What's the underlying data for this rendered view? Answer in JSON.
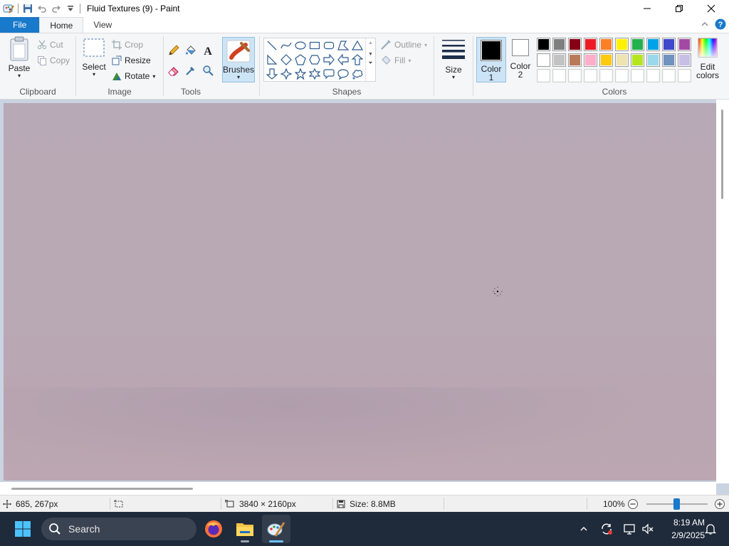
{
  "window": {
    "title": "Fluid Textures (9) - Paint"
  },
  "tabs": [
    {
      "label": "File"
    },
    {
      "label": "Home"
    },
    {
      "label": "View"
    }
  ],
  "clipboard": {
    "paste_label": "Paste",
    "cut_label": "Cut",
    "copy_label": "Copy",
    "group_label": "Clipboard"
  },
  "image": {
    "select_label": "Select",
    "crop_label": "Crop",
    "resize_label": "Resize",
    "rotate_label": "Rotate",
    "group_label": "Image"
  },
  "tools": {
    "group_label": "Tools",
    "icons": [
      "pencil-icon",
      "fill-bucket-icon",
      "text-icon",
      "eraser-icon",
      "color-picker-icon",
      "magnifier-icon"
    ]
  },
  "brushes": {
    "label": "Brushes"
  },
  "shapes": {
    "group_label": "Shapes",
    "outline_label": "Outline",
    "fill_label": "Fill",
    "items": [
      "line",
      "curve",
      "oval",
      "rectangle",
      "rounded-rectangle",
      "polygon",
      "triangle",
      "right-triangle",
      "diamond",
      "pentagon",
      "hexagon",
      "right-arrow",
      "left-arrow",
      "up-arrow",
      "down-arrow",
      "four-point-star",
      "five-point-star",
      "six-point-star",
      "rounded-callout",
      "oval-callout",
      "cloud-callout"
    ]
  },
  "size": {
    "label": "Size"
  },
  "color1": {
    "label_line1": "Color",
    "label_line2": "1",
    "value": "#000000"
  },
  "color2": {
    "label_line1": "Color",
    "label_line2": "2",
    "value": "#ffffff"
  },
  "colors": {
    "group_label": "Colors",
    "edit_label_line1": "Edit",
    "edit_label_line2": "colors",
    "palette_row1": [
      "#000000",
      "#7f7f7f",
      "#880015",
      "#ed1c24",
      "#ff7f27",
      "#fff200",
      "#22b14c",
      "#00a2e8",
      "#3f48cc",
      "#a349a4"
    ],
    "palette_row2": [
      "#ffffff",
      "#c3c3c3",
      "#b97a57",
      "#ffaec9",
      "#ffc90e",
      "#efe4b0",
      "#b5e61d",
      "#99d9ea",
      "#7092be",
      "#c8bfe7"
    ],
    "palette_row3": [
      "#ffffff",
      "#ffffff",
      "#ffffff",
      "#ffffff",
      "#ffffff",
      "#ffffff",
      "#ffffff",
      "#ffffff",
      "#ffffff",
      "#ffffff"
    ]
  },
  "status": {
    "cursor_pos": "685, 267px",
    "image_size": "3840 × 2160px",
    "file_size": "Size: 8.8MB",
    "zoom": "100%"
  },
  "taskbar": {
    "search_label": "Search",
    "time": "8:19 AM",
    "date": "2/9/2025"
  }
}
